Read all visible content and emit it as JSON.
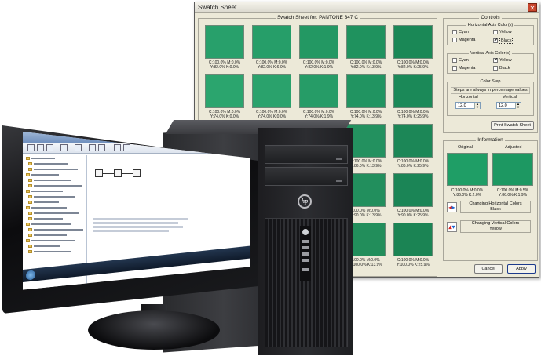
{
  "dialog": {
    "title": "Swatch Sheet",
    "close_glyph": "✕",
    "grid_title": "Swatch Sheet for: PANTONE 347 C",
    "swatches": [
      {
        "c": "#28a06b",
        "l1": "C:100.0% M:0.0%",
        "l2": "Y:82.0% K:0.0%"
      },
      {
        "c": "#269e69",
        "l1": "C:100.0% M:0.0%",
        "l2": "Y:82.0% K:6.0%"
      },
      {
        "c": "#239863",
        "l1": "C:100.0% M:0.0%",
        "l2": "Y:82.0% K:1.9%"
      },
      {
        "c": "#1f925e",
        "l1": "C:100.0% M:0.0%",
        "l2": "Y:82.0% K:13.9%"
      },
      {
        "c": "#1a8856",
        "l1": "C:100.0% M:0.0%",
        "l2": "Y:82.0% K:25.9%"
      },
      {
        "c": "#2ba56e",
        "l1": "C:100.0% M:0.0%",
        "l2": "Y:74.0% K:0.0%"
      },
      {
        "c": "#2aa26c",
        "l1": "C:100.0% M:0.0%",
        "l2": "Y:74.0% K:0.0%"
      },
      {
        "c": "#269c67",
        "l1": "C:100.0% M:0.0%",
        "l2": "Y:74.0% K:1.9%"
      },
      {
        "c": "#219461",
        "l1": "C:100.0% M:0.0%",
        "l2": "Y:74.0% K:13.9%"
      },
      {
        "c": "#1b8958",
        "l1": "C:100.0% M:0.0%",
        "l2": "Y:74.0% K:25.9%"
      },
      {
        "c": "#2ca06c",
        "l1": "",
        "l2": ""
      },
      {
        "c": "#2a9c68",
        "l1": "",
        "l2": ""
      },
      {
        "c": "#279765",
        "l1": "",
        "l2": ""
      },
      {
        "c": "#23915f",
        "l1": "C:100.0% M:0.0%",
        "l2": "Y:86.0% K:13.9%"
      },
      {
        "c": "#1c8757",
        "l1": "C:100.0% M:0.0%",
        "l2": "Y:86.0% K:25.9%"
      },
      {
        "c": "#2b9e69",
        "l1": "",
        "l2": ""
      },
      {
        "c": "#289a66",
        "l1": "",
        "l2": ""
      },
      {
        "c": "#259563",
        "l1": "",
        "l2": ""
      },
      {
        "c": "#228f5d",
        "l1": "100.0% M:0.0%",
        "l2": "Y:90.0% K:13.9%"
      },
      {
        "c": "#1b8556",
        "l1": "C:100.0% M:0.0%",
        "l2": "Y:90.0% K:25.9%"
      },
      {
        "c": "#2a9c66",
        "l1": "",
        "l2": ""
      },
      {
        "c": "#279864",
        "l1": "",
        "l2": ""
      },
      {
        "c": "#249361",
        "l1": "",
        "l2": ""
      },
      {
        "c": "#228e5b",
        "l1": "100.0% M:0.0%",
        "l2": "Y:100.0% K:13.9%"
      },
      {
        "c": "#1b8454",
        "l1": "C:100.0% M:0.0%",
        "l2": "Y:100.0% K:25.9%"
      }
    ],
    "controls": {
      "title": "Controls",
      "horizontal_title": "Horizontal Axis Color(s)",
      "vertical_title": "Vertical Axis Color(s)",
      "cyan": "Cyan",
      "yellow": "Yellow",
      "magenta": "Magenta",
      "black": "Black",
      "check": "✔",
      "color_step_title": "Color Step",
      "step_note": "Steps are always in percentage values",
      "horizontal": "Horizontal",
      "vertical": "Vertical",
      "h_value": "12.0",
      "v_value": "12.0",
      "print_button": "Print Swatch Sheet"
    },
    "information": {
      "title": "Information",
      "original": "Original",
      "adjusted": "Adjusted",
      "original_color": "#1f9e66",
      "adjusted_color": "#1d9862",
      "orig_l1": "C:100.0% M:0.0%",
      "orig_l2": "Y:86.0% K:2.0%",
      "adj_l1": "C:100.0% M:0.5%",
      "adj_l2": "Y:86.0% K:1.9%",
      "changing_horizontal": "Changing Horizontal Colors",
      "horizontal_value": "Black",
      "changing_vertical": "Changing Vertical Colors",
      "vertical_value": "Yellow"
    },
    "cancel": "Cancel",
    "apply": "Apply"
  }
}
